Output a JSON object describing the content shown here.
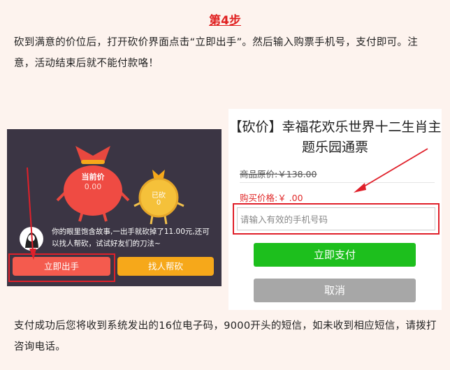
{
  "step_title": "第4步",
  "intro_text": "砍到满意的价位后，打开砍价界面点击“立即出手”。然后输入购票手机号，支付即可。注意，活动结束后就不能付款咯！",
  "left_panel": {
    "bag_big_label": "当前价",
    "bag_big_value": "0.00",
    "bag_small_label": "已砍",
    "bag_small_value": "0",
    "chat_text": "你的眼里饱含故事,一出手就砍掉了11.00元,还可以找人帮砍，试试好友们的刀法~",
    "buy_button": "立即出手",
    "help_button": "找人帮砍"
  },
  "right_panel": {
    "title": "【砍价】幸福花欢乐世界十二生肖主题乐园通票",
    "original_price": "商品原价:￥138.00",
    "purchase_price": "购买价格:￥ .00",
    "phone_placeholder": "请输入有效的手机号码",
    "pay_button": "立即支付",
    "cancel_button": "取消"
  },
  "footer_text": "支付成功后您将收到系统发出的16位电子码，9000开头的短信，如未收到相应短信，请拨打咨询电话。",
  "colors": {
    "accent_red": "#e02020",
    "pay_green": "#1dbf1d",
    "cancel_gray": "#a7a7a7",
    "buy_red": "#f45b4e",
    "help_orange": "#f6a81a"
  }
}
